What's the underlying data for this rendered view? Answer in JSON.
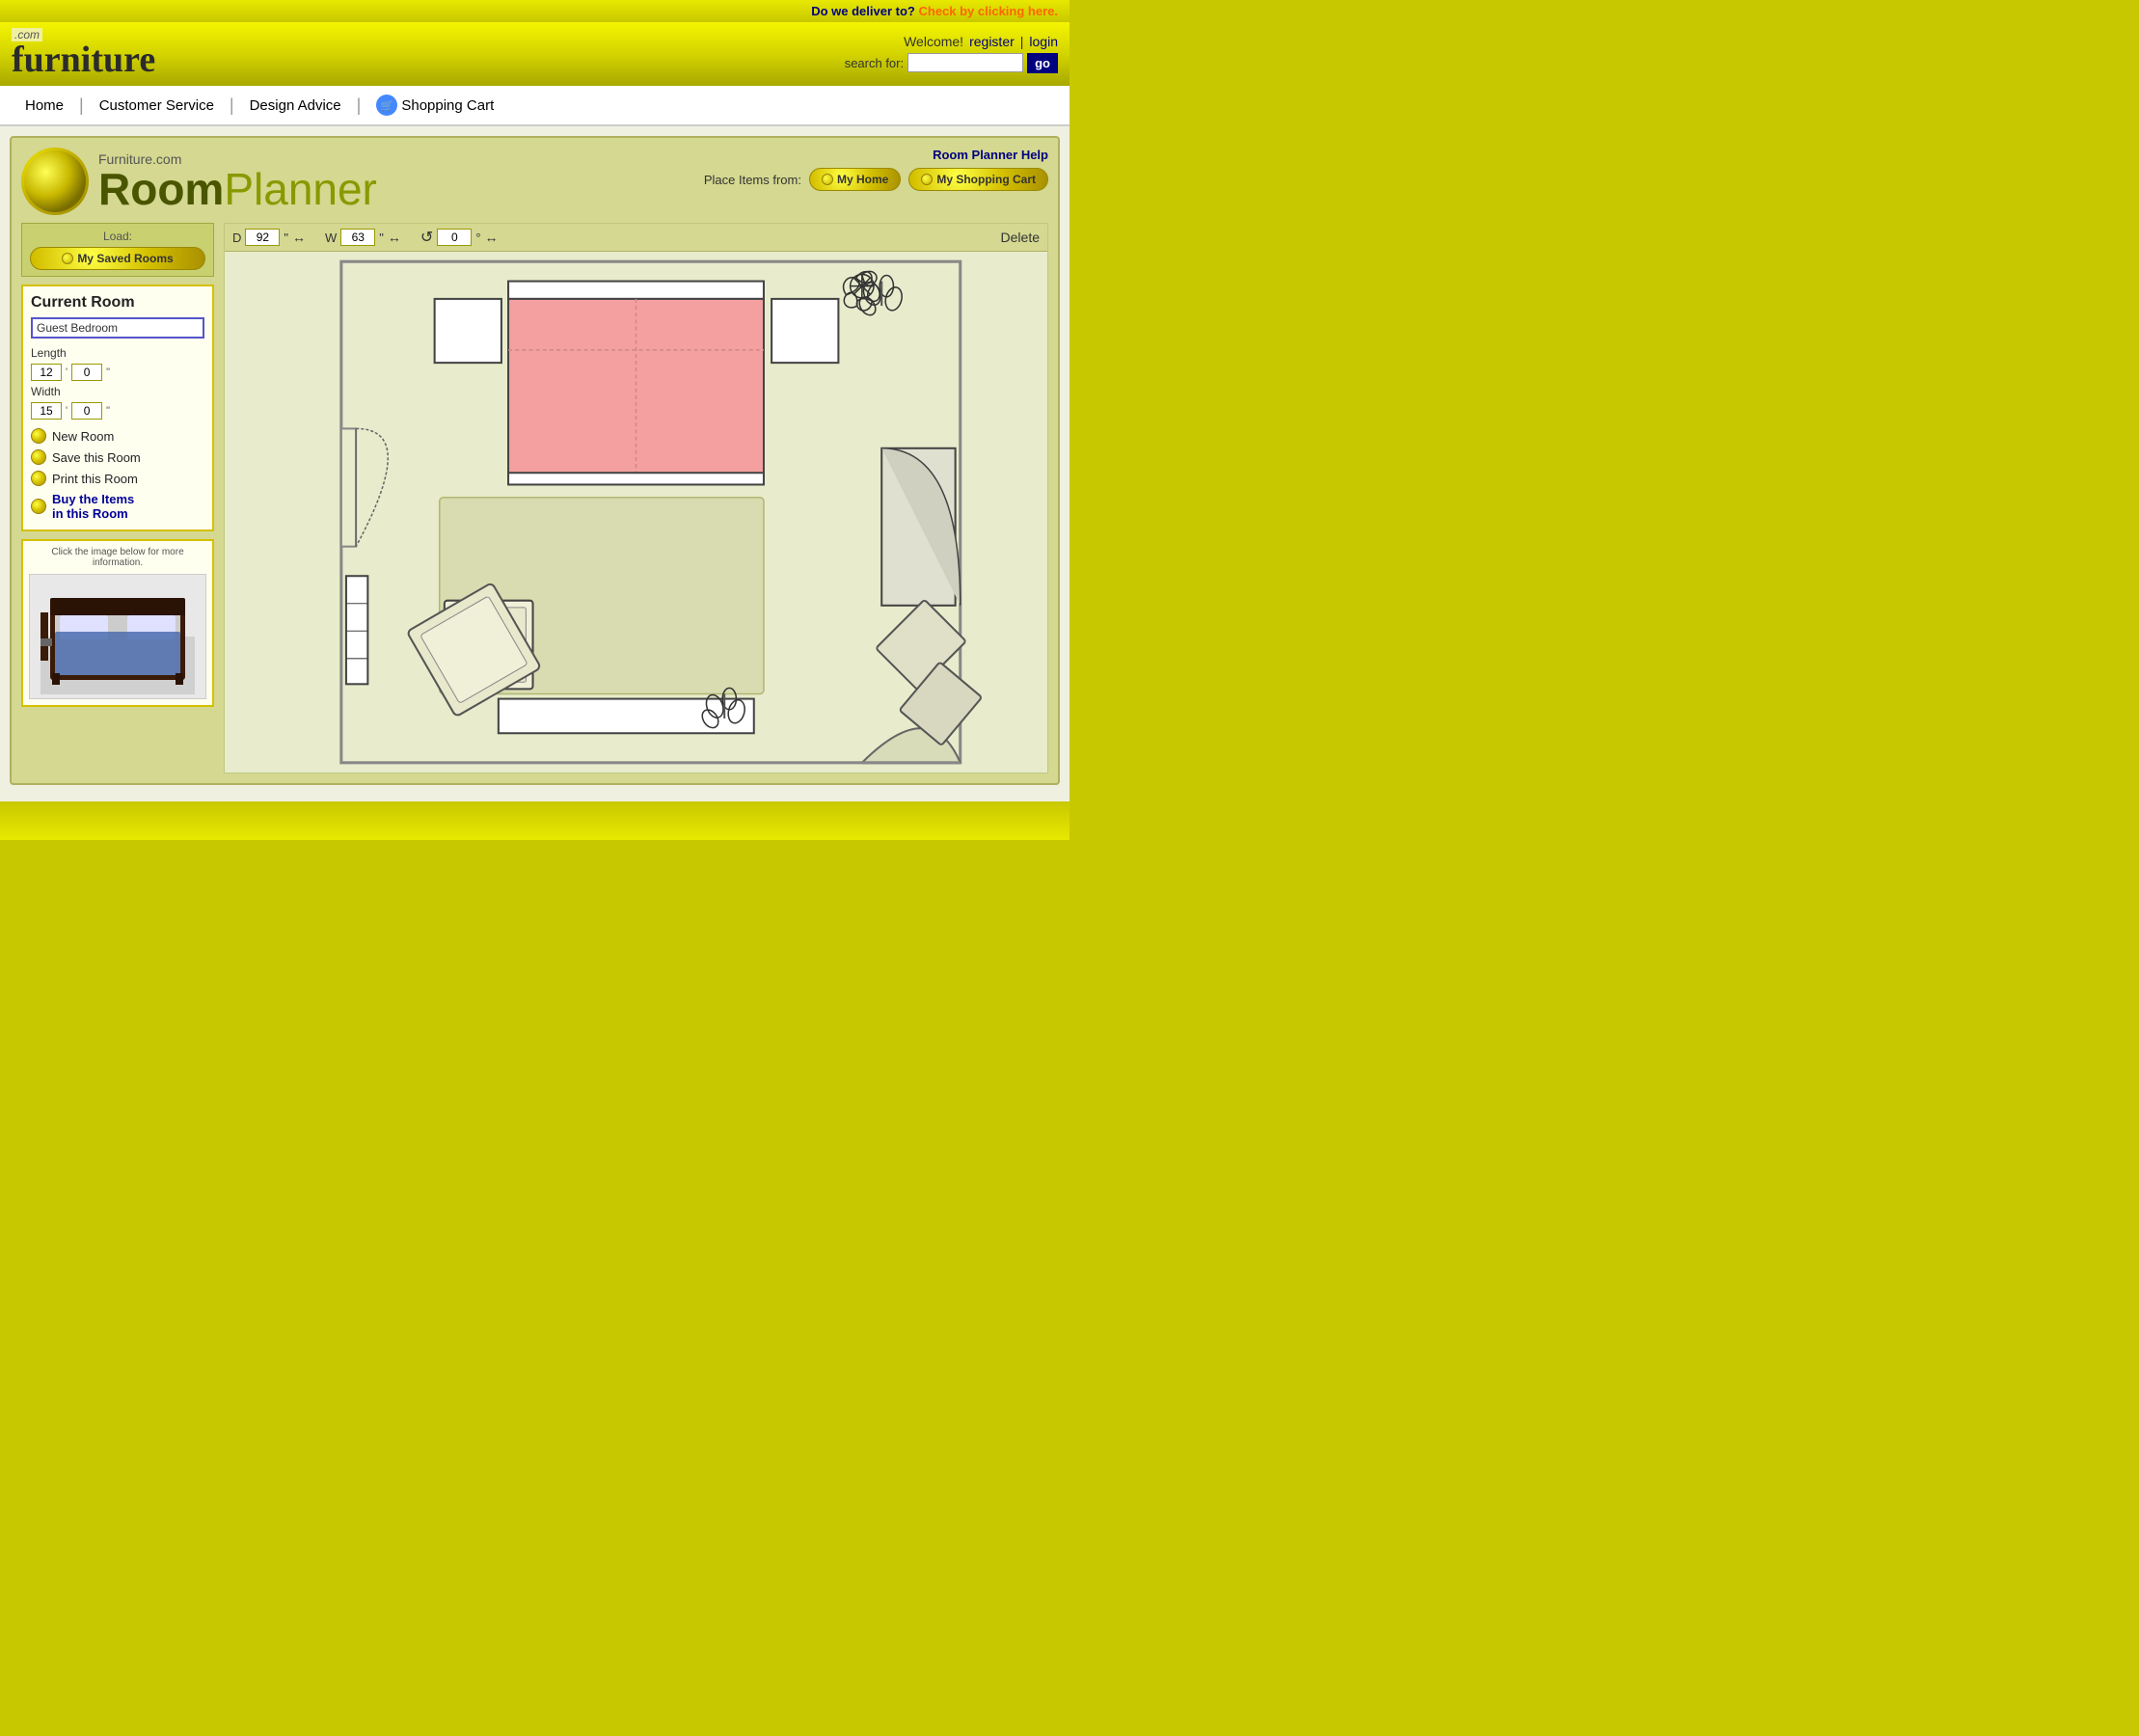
{
  "site": {
    "delivery_label": "Do we deliver to?",
    "delivery_link": "Check by clicking here.",
    "logo_com": ".com",
    "logo_name": "furniture",
    "welcome": "Welcome!",
    "register": "register",
    "separator": "|",
    "login": "login",
    "search_label": "search for:",
    "search_placeholder": "",
    "go_button": "go"
  },
  "nav": {
    "home": "Home",
    "customer_service": "Customer Service",
    "design_advice": "Design Advice",
    "shopping_cart": "Shopping Cart"
  },
  "planner": {
    "help_link": "Room Planner Help",
    "place_items_label": "Place Items from:",
    "my_home_btn": "My Home",
    "my_shopping_cart_btn": "My Shopping Cart",
    "logo_subtitle": "Furniture.com",
    "logo_title_part1": "Room",
    "logo_title_part2": "Planner",
    "dim_d_label": "D",
    "dim_d_value": "92",
    "dim_w_label": "W",
    "dim_w_value": "63",
    "dim_rot_value": "0",
    "dim_unit": "\"",
    "dim_deg": "°",
    "delete_label": "Delete",
    "load_label": "Load:",
    "saved_rooms_btn": "My Saved Rooms",
    "current_room_title": "Current Room",
    "room_name_value": "Guest Bedroom",
    "length_label": "Length",
    "length_ft": "12",
    "length_in": "0",
    "width_label": "Width",
    "width_ft": "15",
    "width_in": "0",
    "new_room_btn": "New Room",
    "save_room_btn": "Save this Room",
    "print_room_btn": "Print this Room",
    "buy_items_btn": "Buy the Items",
    "buy_items_btn2": "in this Room",
    "info_note": "Click the image below for more information."
  }
}
